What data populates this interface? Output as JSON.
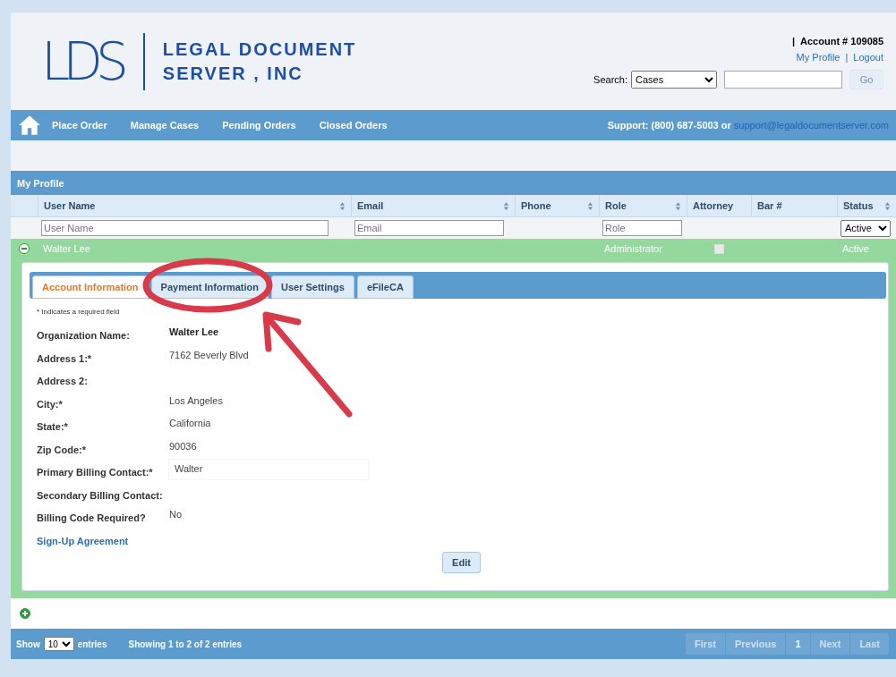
{
  "header": {
    "logo_mark": "LDS",
    "company_line1": "LEGAL DOCUMENT",
    "company_line2": "SERVER , INC",
    "separator": "|",
    "account": "Account # 109085",
    "my_profile": "My Profile",
    "link_separator": "|",
    "logout": "Logout",
    "search_label": "Search:",
    "search_select": "Cases",
    "go": "Go"
  },
  "nav": {
    "items": [
      "Place Order",
      "Manage Cases",
      "Pending Orders",
      "Closed Orders"
    ],
    "support": "Support: (800) 687-5003 or",
    "email": "support@legaldocumentserver.com"
  },
  "panel": {
    "title": "My Profile"
  },
  "table": {
    "columns": [
      {
        "label": "User Name",
        "sortable": true,
        "placeholder": "User Name"
      },
      {
        "label": "Email",
        "sortable": true,
        "placeholder": "Email"
      },
      {
        "label": "Phone",
        "sortable": true
      },
      {
        "label": "Role",
        "sortable": true,
        "placeholder": "Role"
      },
      {
        "label": "Attorney",
        "sortable": false
      },
      {
        "label": "Bar #",
        "sortable": false
      },
      {
        "label": "Status",
        "sortable": true,
        "select": "Active"
      }
    ],
    "rows": [
      {
        "expanded": true,
        "user_name": "Walter Lee",
        "role": "Administrator",
        "attorney": false,
        "status": "Active"
      }
    ]
  },
  "tabs": [
    {
      "label": "Account Information",
      "selected": true
    },
    {
      "label": "Payment Information",
      "selected": false
    },
    {
      "label": "User Settings",
      "selected": false
    },
    {
      "label": "eFileCA",
      "selected": false
    }
  ],
  "note": "* Indicates a required field",
  "fields": [
    {
      "label": "Organization Name:",
      "value": "Walter Lee",
      "kind": "bold"
    },
    {
      "label": "Address 1:*",
      "value": "7162 Beverly Blvd",
      "kind": "text"
    },
    {
      "label": "Address 2:"
    },
    {
      "label": "City:*",
      "value": "Los Angeles",
      "kind": "text"
    },
    {
      "label": "State:*",
      "value": "California",
      "kind": "text"
    },
    {
      "label": "Zip Code:*",
      "value": "90036",
      "kind": "text"
    },
    {
      "label": "Primary Billing Contact:*",
      "value": "Walter",
      "kind": "input"
    },
    {
      "label": "Secondary Billing Contact:"
    },
    {
      "label": "Billing Code Required?",
      "value": "No",
      "kind": "text"
    }
  ],
  "agreement_link": "Sign-Up Agreement",
  "edit_button": "Edit",
  "second_row": {
    "expanded": false
  },
  "footer": {
    "show": "Show",
    "page_size": "10",
    "entries": "entries",
    "info": "Showing 1 to 2 of 2 entries",
    "pager": [
      {
        "label": "First",
        "selected": false
      },
      {
        "label": "Previous",
        "selected": false
      },
      {
        "label": "1",
        "selected": true
      },
      {
        "label": "Next",
        "selected": false
      },
      {
        "label": "Last",
        "selected": false
      }
    ]
  }
}
